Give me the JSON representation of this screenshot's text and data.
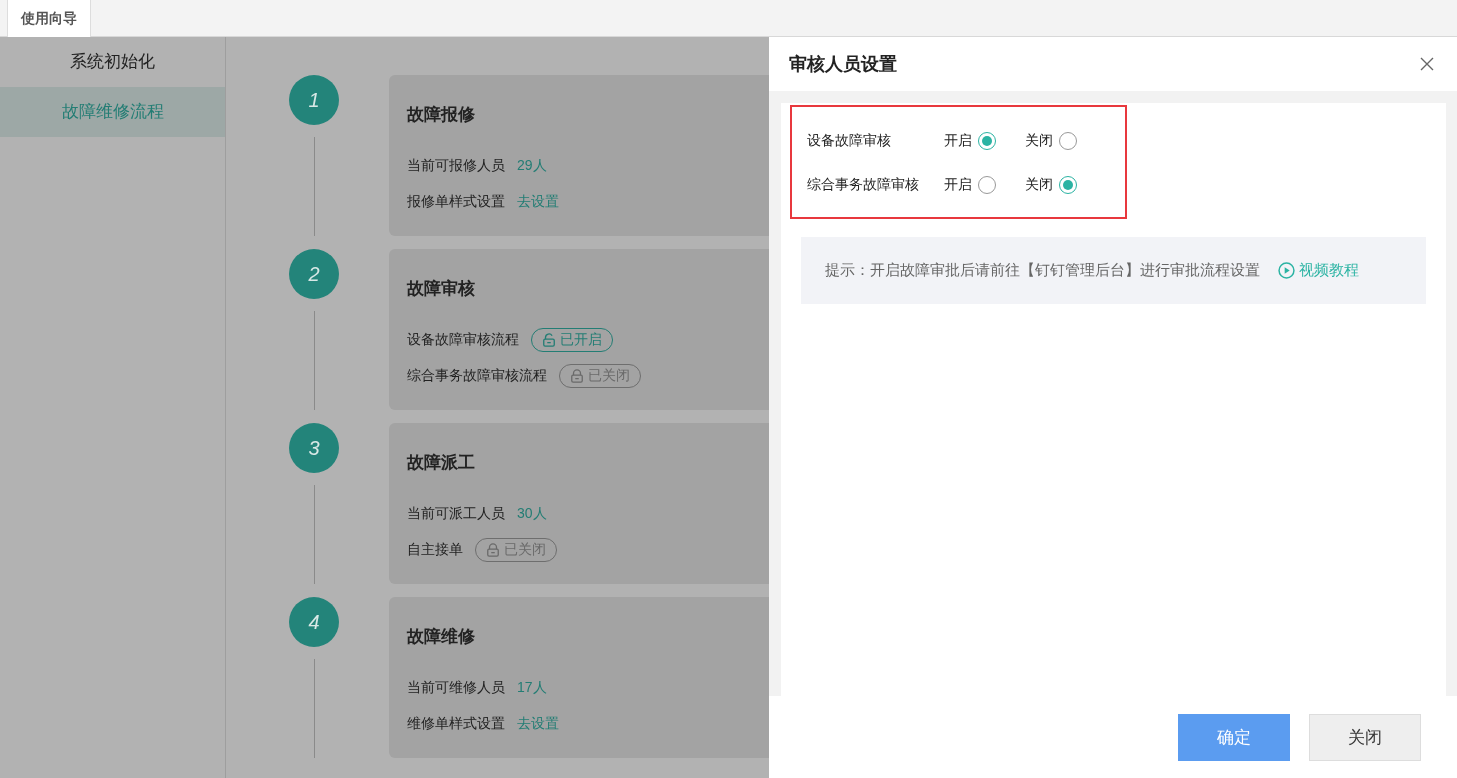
{
  "top_tabs": [
    {
      "label": "使用向导",
      "selected": true
    }
  ],
  "sidebar": {
    "items": [
      {
        "label": "系统初始化",
        "selected": false
      },
      {
        "label": "故障维修流程",
        "selected": true
      }
    ]
  },
  "steps": [
    {
      "number": "1",
      "title": "故障报修",
      "rows": [
        {
          "label": "当前可报修人员",
          "kind": "value",
          "value": "29人"
        },
        {
          "label": "报修单样式设置",
          "kind": "link",
          "value": "去设置"
        }
      ]
    },
    {
      "number": "2",
      "title": "故障审核",
      "rows": [
        {
          "label": "设备故障审核流程",
          "kind": "badge",
          "value": "已开启",
          "on": true
        },
        {
          "label": "综合事务故障审核流程",
          "kind": "badge",
          "value": "已关闭",
          "on": false
        }
      ]
    },
    {
      "number": "3",
      "title": "故障派工",
      "rows": [
        {
          "label": "当前可派工人员",
          "kind": "value",
          "value": "30人"
        },
        {
          "label": "自主接单",
          "kind": "badge",
          "value": "已关闭",
          "on": false
        }
      ]
    },
    {
      "number": "4",
      "title": "故障维修",
      "rows": [
        {
          "label": "当前可维修人员",
          "kind": "value",
          "value": "17人"
        },
        {
          "label": "维修单样式设置",
          "kind": "link",
          "value": "去设置"
        }
      ]
    }
  ],
  "drawer": {
    "title": "审核人员设置",
    "options": [
      {
        "label": "设备故障审核",
        "choices": [
          {
            "label": "开启",
            "selected": true
          },
          {
            "label": "关闭",
            "selected": false
          }
        ]
      },
      {
        "label": "综合事务故障审核",
        "choices": [
          {
            "label": "开启",
            "selected": false
          },
          {
            "label": "关闭",
            "selected": true
          }
        ]
      }
    ],
    "tip": "提示：开启故障审批后请前往【钉钉管理后台】进行审批流程设置",
    "tip_link": "视频教程",
    "buttons": [
      {
        "label": "确定",
        "kind": "primary"
      },
      {
        "label": "关闭",
        "kind": "default"
      }
    ]
  }
}
